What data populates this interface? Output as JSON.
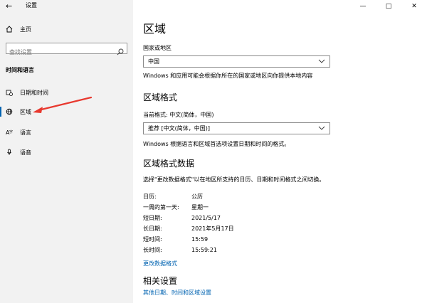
{
  "window": {
    "app_title": "设置"
  },
  "sidebar": {
    "home_label": "主页",
    "search_placeholder": "查找设置",
    "section_heading": "时间和语言",
    "items": [
      {
        "label": "日期和时间",
        "icon": "calendar-clock-icon"
      },
      {
        "label": "区域",
        "icon": "globe-icon",
        "active": true
      },
      {
        "label": "语言",
        "icon": "language-icon"
      },
      {
        "label": "语音",
        "icon": "microphone-icon"
      }
    ]
  },
  "main": {
    "title": "区域",
    "country": {
      "label": "国家或地区",
      "value": "中国",
      "description": "Windows 和应用可能会根据你所在的国家或地区向你提供本地内容"
    },
    "format": {
      "heading": "区域格式",
      "current_label": "当前格式: 中文(简体，中国)",
      "value": "推荐 [中文(简体，中国)]",
      "description": "Windows 根据语言和区域首选项设置日期和时间的格式。"
    },
    "format_data": {
      "heading": "区域格式数据",
      "description": "选择\"更改数据格式\"以在地区所支持的日历、日期和时间格式之间切换。",
      "rows": [
        {
          "key": "日历:",
          "value": "公历"
        },
        {
          "key": "一周的第一天:",
          "value": "星期一"
        },
        {
          "key": "短日期:",
          "value": "2021/5/17"
        },
        {
          "key": "长日期:",
          "value": "2021年5月17日"
        },
        {
          "key": "短时间:",
          "value": "15:59"
        },
        {
          "key": "长时间:",
          "value": "15:59:21"
        }
      ],
      "change_link": "更改数据格式"
    },
    "related": {
      "heading": "相关设置",
      "link": "其他日期、时间和区域设置"
    }
  },
  "colors": {
    "accent": "#0063b1",
    "annotation": "#e8382e"
  }
}
